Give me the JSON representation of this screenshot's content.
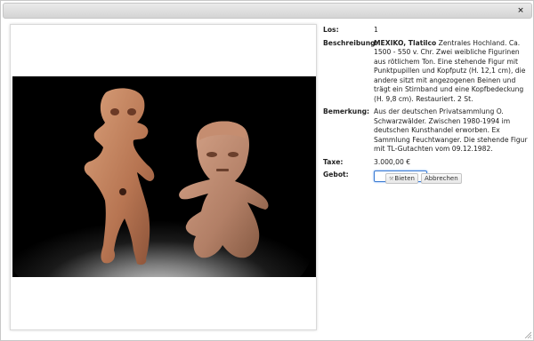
{
  "dialog": {
    "close_icon": "×"
  },
  "image": {
    "alt": "Two Tlatilco clay figurines on black background"
  },
  "details": {
    "los_label": "Los:",
    "los_value": "1",
    "beschreibung_label": "Beschreibung:",
    "beschreibung_title": "MEXIKO, Tlatilco",
    "beschreibung_text": " Zentrales Hochland. Ca. 1500 - 550 v. Chr. Zwei weibliche Figurinen aus rötlichem Ton. Eine stehende Figur mit Punktpupillen und Kopfputz (H. 12,1 cm), die andere sitzt mit angezogenen Beinen und trägt ein Stirnband und eine Kopfbedeckung (H. 9,8 cm). Restauriert. 2 St.",
    "bemerkung_label": "Bemerkung:",
    "bemerkung_text": "Aus der deutschen Privatsammlung O. Schwarzwälder. Zwischen 1980-1994 im deutschen Kunsthandel erworben. Ex Sammlung Feuchtwanger. Die stehende Figur mit TL-Gutachten vom 09.12.1982.",
    "taxe_label": "Taxe:",
    "taxe_value": "3.000,00 €",
    "gebot_label": "Gebot:",
    "gebot_value": ""
  },
  "buttons": {
    "bieten_label": "Bieten",
    "bieten_icon": "hammer-icon",
    "abbrechen_label": "Abbrechen"
  }
}
